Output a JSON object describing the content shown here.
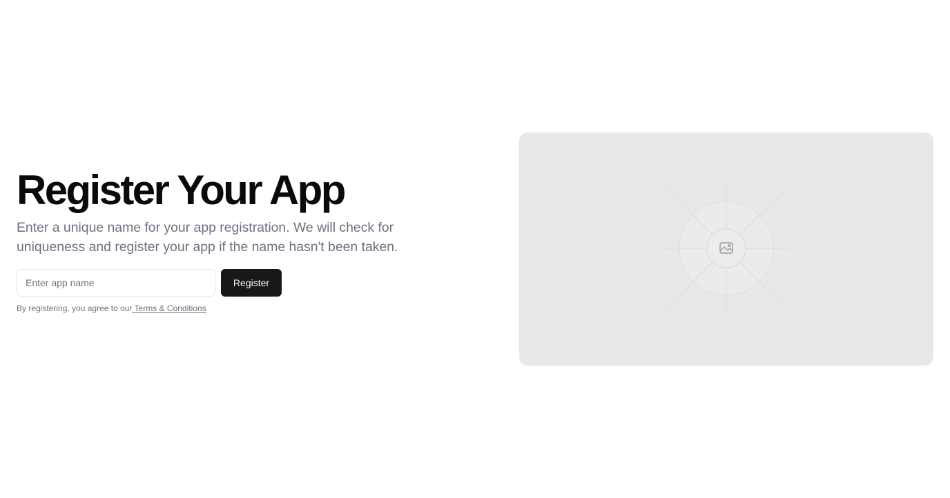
{
  "hero": {
    "title": "Register Your App",
    "description": "Enter a unique name for your app registration. We will check for uniqueness and register your app if the name hasn't been taken."
  },
  "form": {
    "input_placeholder": "Enter app name",
    "input_value": "",
    "register_label": "Register"
  },
  "terms": {
    "prefix": "By registering, you agree to our",
    "link_label": " Terms & Conditions"
  },
  "media": {
    "icon": "image-icon"
  }
}
